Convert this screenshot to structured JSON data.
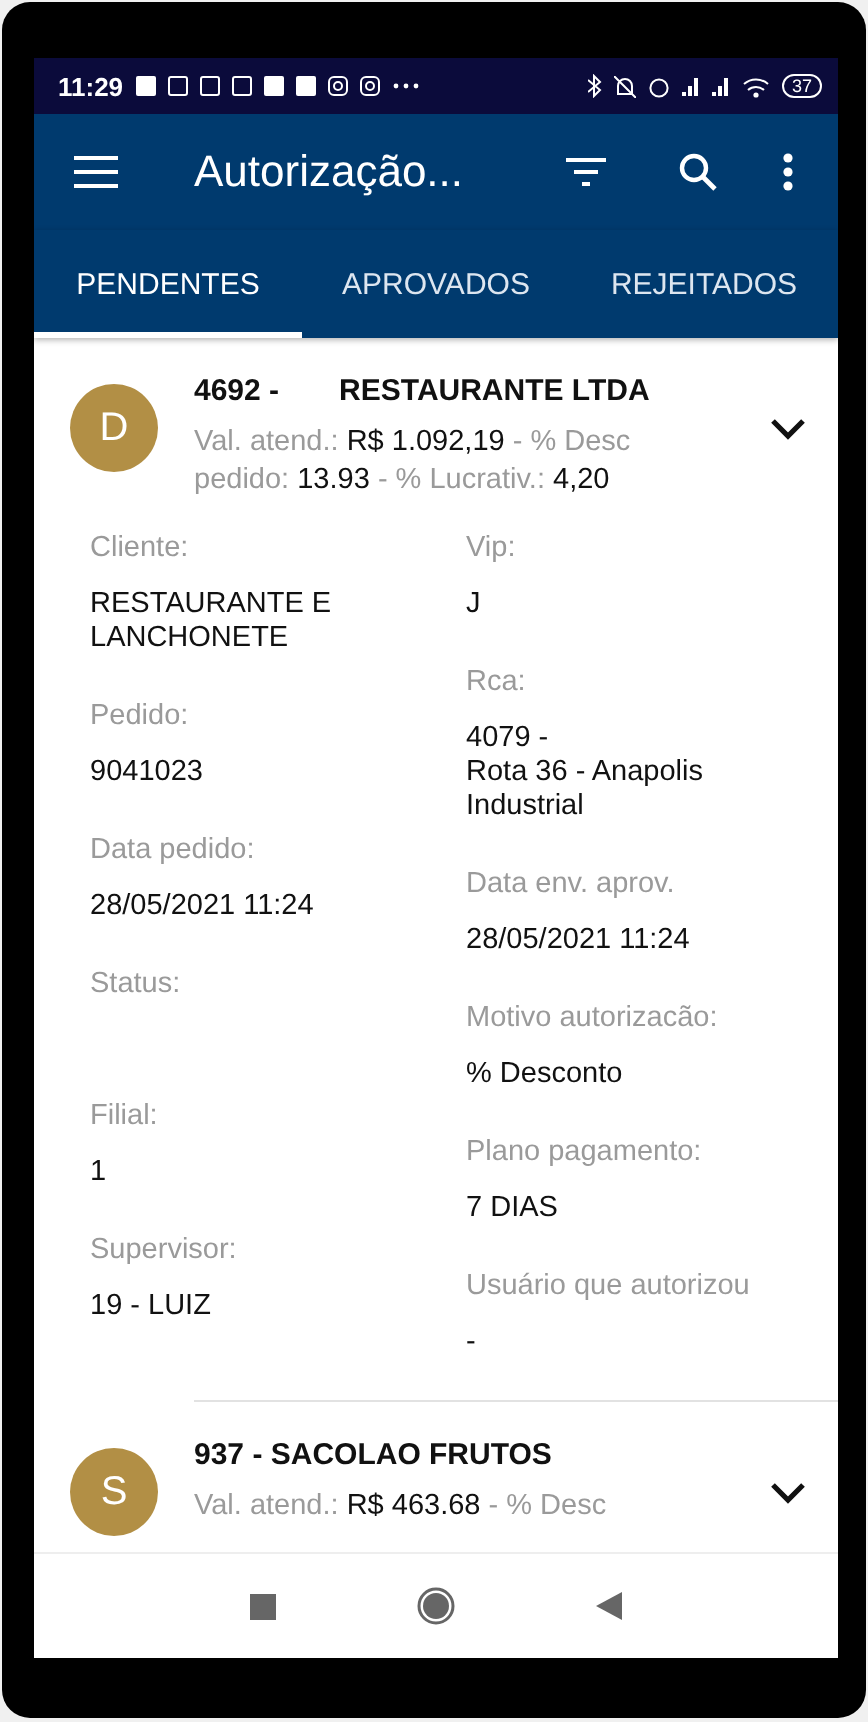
{
  "status_bar": {
    "time": "11:29",
    "battery": "37"
  },
  "app_bar": {
    "title": "Autorização..."
  },
  "tabs": [
    {
      "label": "PENDENTES",
      "selected": true
    },
    {
      "label": "APROVADOS",
      "selected": false
    },
    {
      "label": "REJEITADOS",
      "selected": false
    }
  ],
  "orders": [
    {
      "avatar": "D",
      "title": [
        "4692 -",
        "RESTAURANTE LTDA"
      ],
      "summary": [
        {
          "kind": "label",
          "text": "Val. atend.:"
        },
        {
          "kind": "value",
          "text": "R$  1.092,19"
        },
        {
          "kind": "label",
          "text": "- % Desc pedido:"
        },
        {
          "kind": "value",
          "text": "13.93"
        },
        {
          "kind": "label",
          "text": "- % Lucrativ.:"
        },
        {
          "kind": "value",
          "text": "4,20"
        }
      ],
      "details": {
        "left": [
          {
            "label": "Cliente:",
            "value": "RESTAURANTE E LANCHONETE"
          },
          {
            "label": "Pedido:",
            "value": "9041023"
          },
          {
            "label": "Data pedido:",
            "value": "28/05/2021 11:24"
          },
          {
            "label": "Status:"
          },
          {
            "label": "Filial:",
            "value": "1"
          },
          {
            "label": "Supervisor:",
            "value": "19 - LUIZ"
          }
        ],
        "right": [
          {
            "label": "Vip:",
            "value": "J"
          },
          {
            "label": "Rca:",
            "value": "4079 -\nRota 36 - Anapolis Industrial"
          },
          {
            "label": "Data env. aprov.",
            "value": "28/05/2021 11:24"
          },
          {
            "label": "Motivo autorizacão:",
            "value": "% Desconto"
          },
          {
            "label": "Plano pagamento:",
            "value": "7 DIAS"
          },
          {
            "label": "Usuário que autorizou",
            "value": "-"
          }
        ]
      }
    },
    {
      "avatar": "S",
      "title": [
        "937 - SACOLAO FRUTOS"
      ],
      "summary": [
        {
          "kind": "label",
          "text": "Val. atend.:"
        },
        {
          "kind": "value",
          "text": "R$  463.68"
        },
        {
          "kind": "label",
          "text": "- % Desc"
        }
      ]
    }
  ]
}
